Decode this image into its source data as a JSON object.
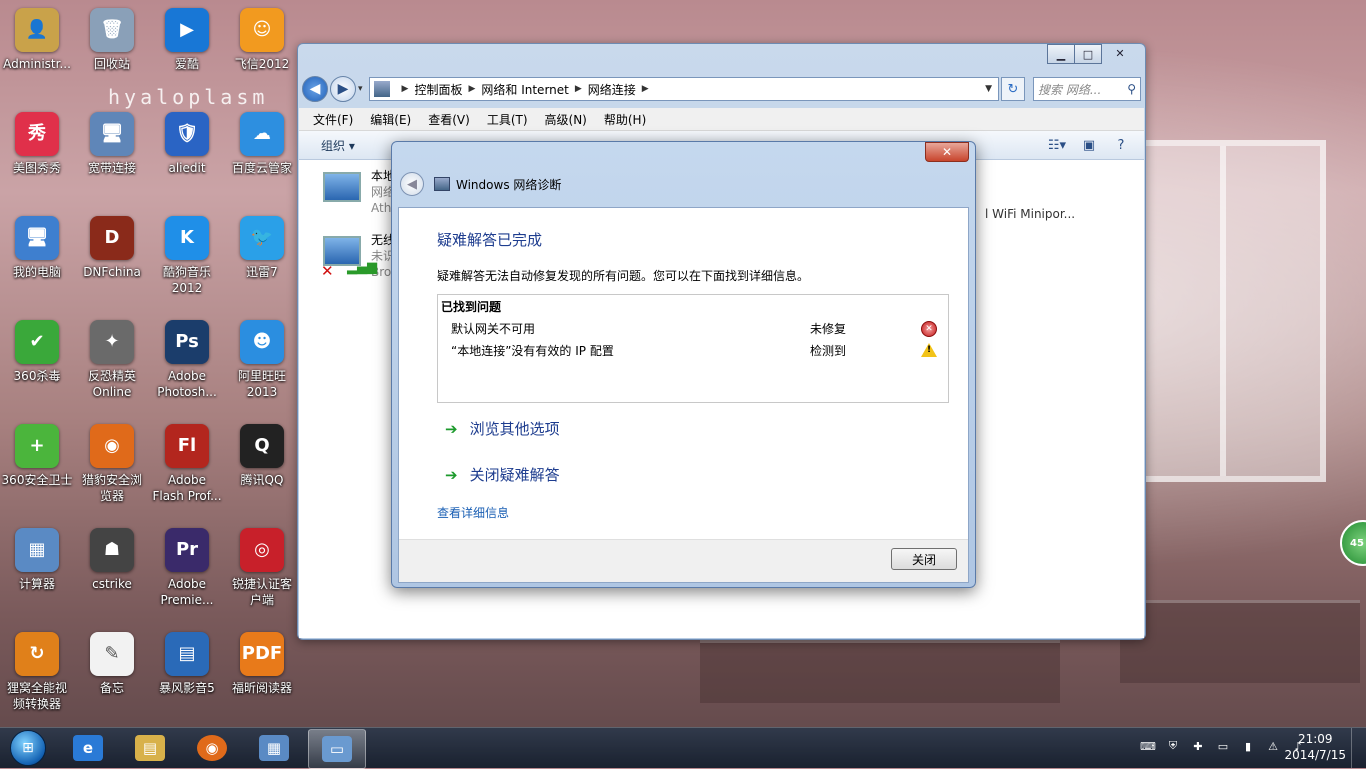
{
  "desktop": {
    "watermark": "hyaloplasm",
    "icons": [
      {
        "label": "Administr...",
        "color": "#c9a24a",
        "glyph": "👤"
      },
      {
        "label": "回收站",
        "color": "#8aa0b8",
        "glyph": "🗑"
      },
      {
        "label": "爱酷",
        "color": "#1877d6",
        "glyph": "▶"
      },
      {
        "label": "飞信2012",
        "color": "#f29a1f",
        "glyph": "☺"
      },
      {
        "label": "美图秀秀",
        "color": "#e0304a",
        "glyph": "秀"
      },
      {
        "label": "宽带连接",
        "color": "#5f86b8",
        "glyph": "🖥"
      },
      {
        "label": "aliedit",
        "color": "#2a64c4",
        "glyph": "🛡"
      },
      {
        "label": "百度云管家",
        "color": "#2d8fe0",
        "glyph": "☁"
      },
      {
        "label": "我的电脑",
        "color": "#3e7fcf",
        "glyph": "🖥"
      },
      {
        "label": "DNFchina",
        "color": "#8a2a1a",
        "glyph": "D"
      },
      {
        "label": "酷狗音乐\n2012",
        "color": "#1f8fe8",
        "glyph": "K"
      },
      {
        "label": "迅雷7",
        "color": "#2aa0e8",
        "glyph": "🐦"
      },
      {
        "label": "360杀毒",
        "color": "#3aa83a",
        "glyph": "✔"
      },
      {
        "label": "反恐精英\nOnline",
        "color": "#6a6a6a",
        "glyph": "✦"
      },
      {
        "label": "Adobe\nPhotosh...",
        "color": "#1b3d6b",
        "glyph": "Ps"
      },
      {
        "label": "阿里旺旺\n2013",
        "color": "#2b8ee0",
        "glyph": "☻"
      },
      {
        "label": "360安全卫士",
        "color": "#4bb53c",
        "glyph": "+"
      },
      {
        "label": "猎豹安全浏\n览器",
        "color": "#e06a1a",
        "glyph": "◉"
      },
      {
        "label": "Adobe\nFlash Prof...",
        "color": "#b3261e",
        "glyph": "Fl"
      },
      {
        "label": "腾讯QQ",
        "color": "#222",
        "glyph": "Q"
      },
      {
        "label": "计算器",
        "color": "#5a8ac4",
        "glyph": "▦"
      },
      {
        "label": "cstrike",
        "color": "#444",
        "glyph": "☗"
      },
      {
        "label": "Adobe\nPremie...",
        "color": "#3a2a6a",
        "glyph": "Pr"
      },
      {
        "label": "锐捷认证客\n户端",
        "color": "#c8202a",
        "glyph": "◎"
      },
      {
        "label": "狸窝全能视\n频转换器",
        "color": "#e0801a",
        "glyph": "↻"
      },
      {
        "label": "备忘",
        "color": "#f2f2f2",
        "glyph": "✎"
      },
      {
        "label": "暴风影音5",
        "color": "#2a6ab8",
        "glyph": "▤"
      },
      {
        "label": "福昕阅读器",
        "color": "#e87a1a",
        "glyph": "PDF"
      }
    ]
  },
  "explorer": {
    "breadcrumb": [
      "控制面板",
      "网络和 Internet",
      "网络连接"
    ],
    "search_placeholder": "搜索 网络...",
    "menu": [
      "文件(F)",
      "编辑(E)",
      "查看(V)",
      "工具(T)",
      "高级(N)",
      "帮助(H)"
    ],
    "organize": "组织 ▾",
    "connections": [
      {
        "name": "本地",
        "line2": "网络",
        "line3": "Ath"
      },
      {
        "name": "无线",
        "line2": "未识",
        "line3": "Bro"
      }
    ],
    "truncated_text": "l WiFi Minipor..."
  },
  "dialog": {
    "title": "Windows 网络诊断",
    "close": "✕",
    "heading": "疑难解答已完成",
    "description": "疑难解答无法自动修复发现的所有问题。您可以在下面找到详细信息。",
    "problems_header": "已找到问题",
    "problems": [
      {
        "text": "默认网关不可用",
        "status": "未修复",
        "icon": "error"
      },
      {
        "text": "“本地连接”没有有效的 IP 配置",
        "status": "检测到",
        "icon": "warning"
      }
    ],
    "option_browse": "浏览其他选项",
    "option_close": "关闭疑难解答",
    "details_link": "查看详细信息",
    "close_button": "关闭"
  },
  "taskbar": {
    "time": "21:09",
    "date": "2014/7/15"
  },
  "float_ball": "45"
}
